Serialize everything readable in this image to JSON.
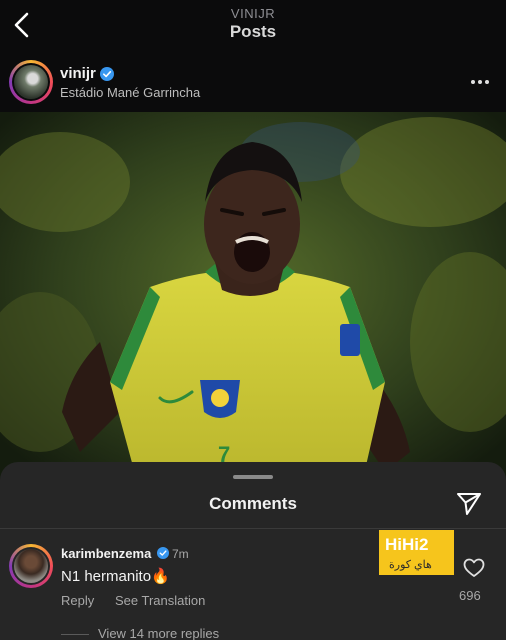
{
  "header": {
    "username": "VINIJR",
    "title": "Posts"
  },
  "post": {
    "author": "vinijr",
    "location": "Estádio Mané Garrincha",
    "jersey_number": "7"
  },
  "comments_sheet": {
    "title": "Comments",
    "comment": {
      "author": "karimbenzema",
      "time": "7m",
      "text": "N1 hermanito🔥",
      "reply_label": "Reply",
      "translate_label": "See Translation",
      "like_count": "696",
      "view_replies_label": "View 14 more replies"
    }
  },
  "watermark": {
    "brand": "HiHi2",
    "arabic": "هاي كورة"
  },
  "colors": {
    "verified": "#3897f0",
    "jersey": "#d4d13a",
    "sheet_bg": "#262626"
  }
}
